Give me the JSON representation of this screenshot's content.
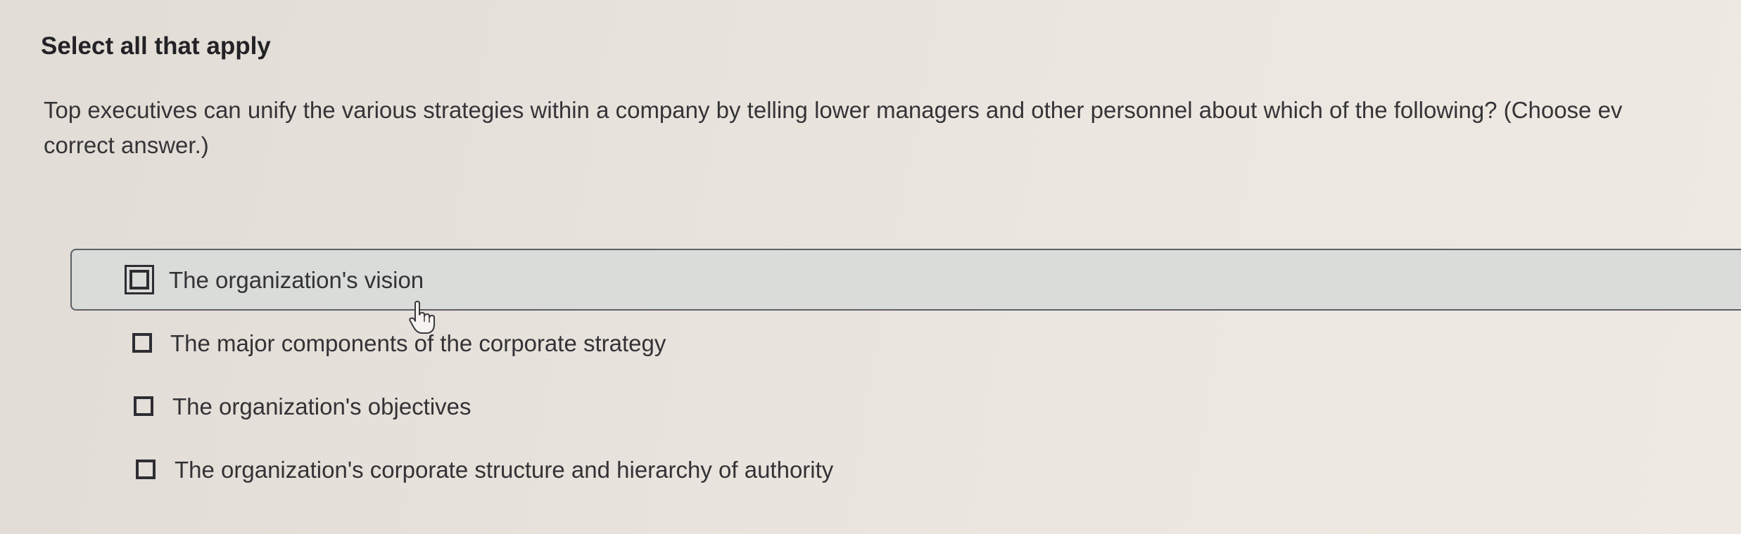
{
  "question": {
    "type_label": "Select all that apply",
    "text_line1": "Top executives can unify the various strategies within a company by telling lower managers and other personnel about which of the following? (Choose ev",
    "text_line2": "correct answer.)"
  },
  "options": [
    {
      "label": "The organization's vision",
      "checked": false,
      "highlighted": true
    },
    {
      "label": "The major components of the corporate strategy",
      "checked": false,
      "highlighted": false
    },
    {
      "label": "The organization's objectives",
      "checked": false,
      "highlighted": false
    },
    {
      "label": "The organization's corporate structure and hierarchy of authority",
      "checked": false,
      "highlighted": false
    }
  ],
  "icons": {
    "checkbox": "checkbox-icon",
    "cursor": "hand-pointer-icon"
  }
}
